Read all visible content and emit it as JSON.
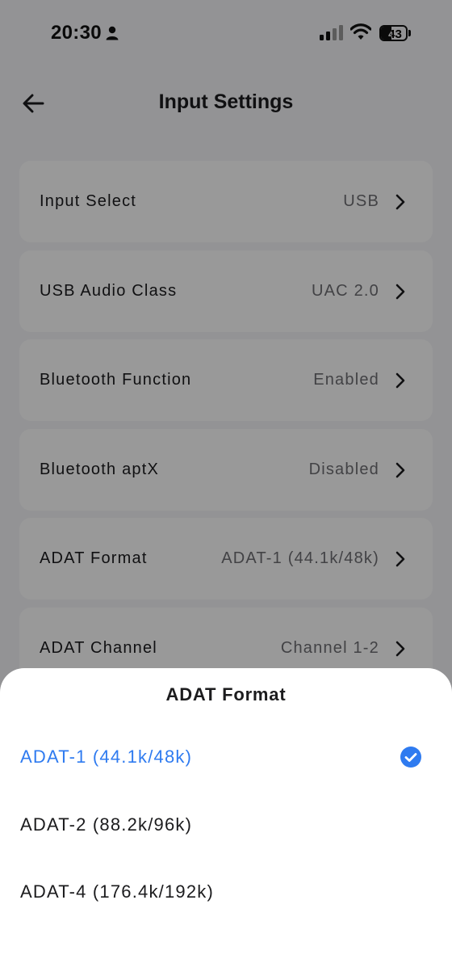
{
  "status_bar": {
    "time": "20:30",
    "battery_level": "43",
    "battery_fraction": 0.43,
    "icons": [
      "person-icon",
      "signal-icon",
      "wifi-icon",
      "battery-icon"
    ]
  },
  "header": {
    "title": "Input Settings",
    "back_icon": "arrow-left-icon"
  },
  "settings": {
    "items": [
      {
        "label": "Input Select",
        "value": "USB"
      },
      {
        "label": "USB Audio Class",
        "value": "UAC 2.0"
      },
      {
        "label": "Bluetooth Function",
        "value": "Enabled"
      },
      {
        "label": "Bluetooth aptX",
        "value": "Disabled"
      },
      {
        "label": "ADAT Format",
        "value": "ADAT-1 (44.1k/48k)"
      },
      {
        "label": "ADAT Channel",
        "value": "Channel 1-2"
      }
    ]
  },
  "sheet": {
    "title": "ADAT Format",
    "options": [
      {
        "label": "ADAT-1 (44.1k/48k)",
        "selected": true
      },
      {
        "label": "ADAT-2 (88.2k/96k)",
        "selected": false
      },
      {
        "label": "ADAT-4 (176.4k/192k)",
        "selected": false
      }
    ]
  },
  "colors": {
    "accent": "#2f7bf0",
    "overlay": "rgba(0,0,0,0.4)",
    "row_background": "#ffffff",
    "value_text": "#6e6e73"
  }
}
